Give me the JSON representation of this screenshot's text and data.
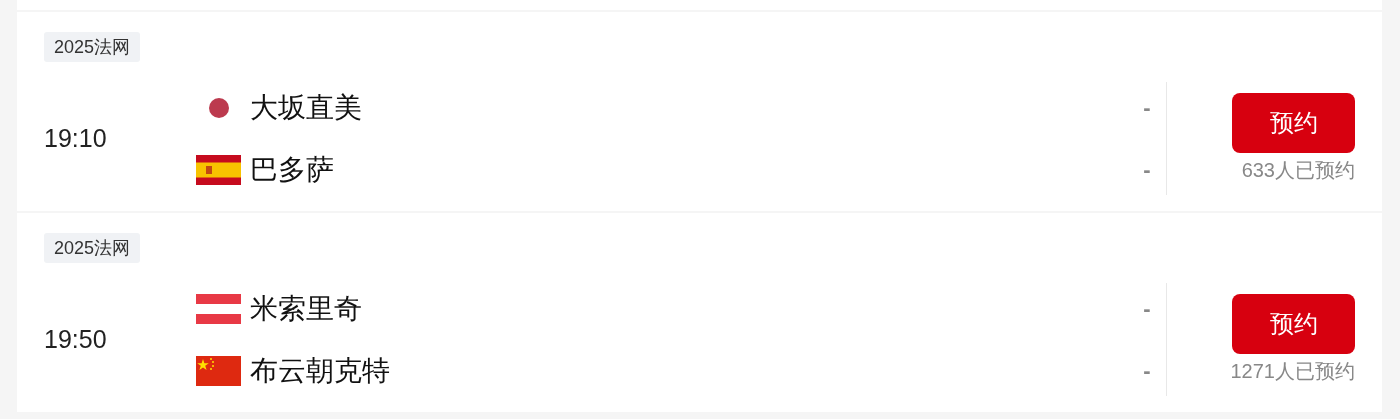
{
  "matches": [
    {
      "tag": "2025法网",
      "time": "19:10",
      "players": [
        {
          "name": "大坂直美",
          "kind": "japan",
          "score": "-"
        },
        {
          "name": "巴多萨",
          "kind": "spain",
          "score": "-"
        }
      ],
      "button": "预约",
      "count": "633人已预约"
    },
    {
      "tag": "2025法网",
      "time": "19:50",
      "players": [
        {
          "name": "米索里奇",
          "kind": "austria",
          "score": "-"
        },
        {
          "name": "布云朝克特",
          "kind": "china",
          "score": "-"
        }
      ],
      "button": "预约",
      "count": "1271人已预约"
    }
  ]
}
